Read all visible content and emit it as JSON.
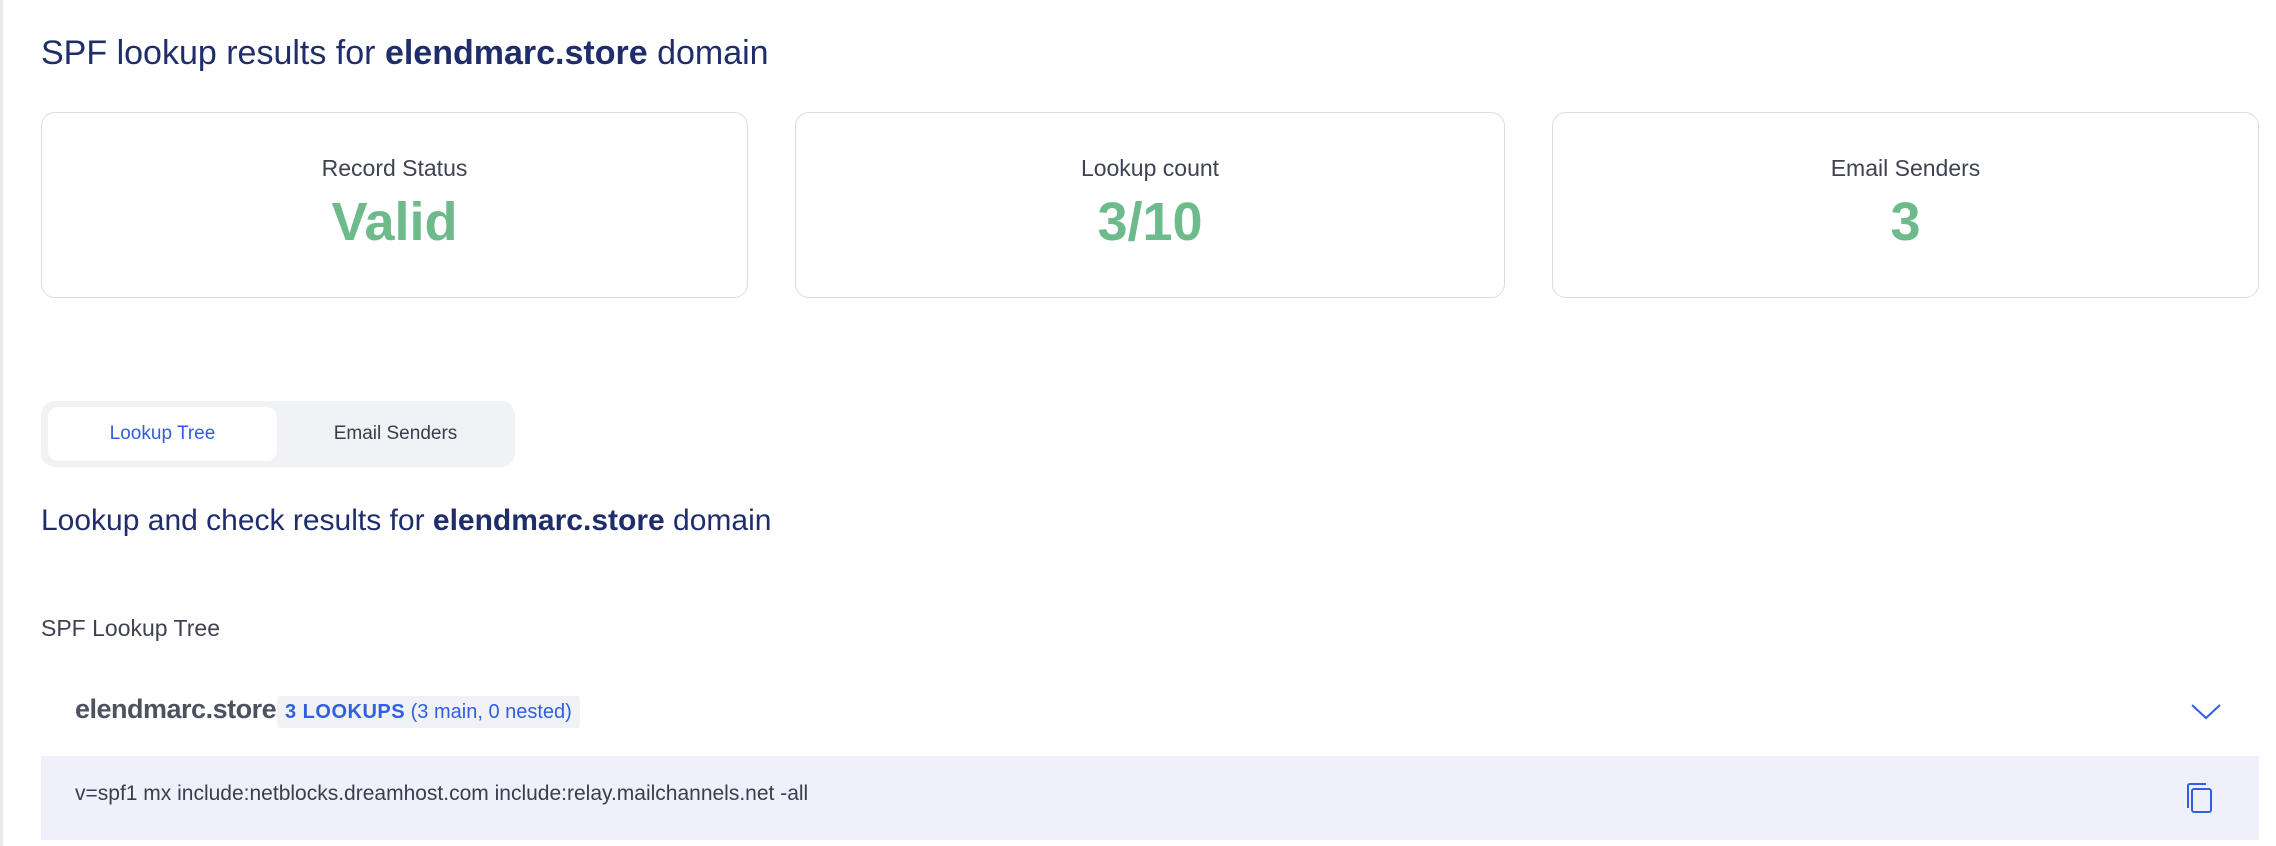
{
  "header": {
    "title_prefix": "SPF lookup results for",
    "domain": "elendmarc.store",
    "title_suffix": "domain"
  },
  "stats": [
    {
      "label": "Record Status",
      "value": "Valid"
    },
    {
      "label": "Lookup count",
      "value": "3/10"
    },
    {
      "label": "Email Senders",
      "value": "3"
    }
  ],
  "tabs": [
    {
      "label": "Lookup Tree",
      "active": true
    },
    {
      "label": "Email Senders",
      "active": false
    }
  ],
  "section": {
    "title_prefix": "Lookup and check results for",
    "domain": "elendmarc.store",
    "title_suffix": "domain"
  },
  "tree": {
    "label": "SPF Lookup Tree",
    "root": {
      "domain": "elendmarc.store",
      "lookups_count": "3 LOOKUPS",
      "lookups_detail": "(3 main, 0 nested)",
      "record": "v=spf1 mx include:netblocks.dreamhost.com include:relay.mailchannels.net -all"
    }
  },
  "icons": {
    "expand": "chevron-down-icon",
    "copy": "copy-icon"
  },
  "colors": {
    "primary_text": "#1f2d6b",
    "accent_blue": "#3060e0",
    "success_green": "#6dba8b",
    "record_bg": "#eff0fa"
  }
}
